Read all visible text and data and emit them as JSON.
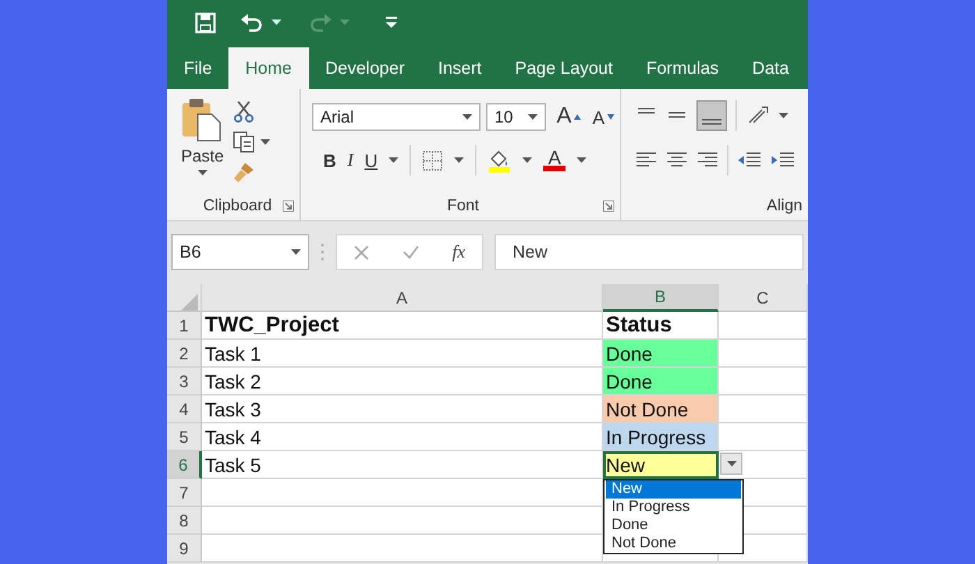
{
  "tabs": [
    {
      "label": "File",
      "selected": false
    },
    {
      "label": "Home",
      "selected": true
    },
    {
      "label": "Developer",
      "selected": false
    },
    {
      "label": "Insert",
      "selected": false
    },
    {
      "label": "Page Layout",
      "selected": false
    },
    {
      "label": "Formulas",
      "selected": false
    },
    {
      "label": "Data",
      "selected": false
    }
  ],
  "ribbon": {
    "clipboard": {
      "paste_label": "Paste",
      "label": "Clipboard"
    },
    "font": {
      "font_name": "Arial",
      "font_size": "10",
      "grow_label": "A",
      "shrink_label": "A",
      "bold_label": "B",
      "italic_label": "I",
      "underline_label": "U",
      "font_color_label": "A",
      "label": "Font"
    },
    "alignment": {
      "label": "Align"
    }
  },
  "formula_bar": {
    "name_box": "B6",
    "function_label": "fx",
    "value": "New"
  },
  "columns": [
    {
      "label": "A",
      "selected": false
    },
    {
      "label": "B",
      "selected": true
    },
    {
      "label": "C",
      "selected": false
    }
  ],
  "rows": [
    {
      "number": "1",
      "kind": "header",
      "selected": false,
      "a": "TWC_Project",
      "b": "Status"
    },
    {
      "number": "2",
      "kind": "data",
      "selected": false,
      "a": "Task 1",
      "b": "Done",
      "color": "#66ff99"
    },
    {
      "number": "3",
      "kind": "data",
      "selected": false,
      "a": "Task 2",
      "b": "Done",
      "color": "#66ff99"
    },
    {
      "number": "4",
      "kind": "data",
      "selected": false,
      "a": "Task 3",
      "b": "Not Done",
      "color": "#f8cbad"
    },
    {
      "number": "5",
      "kind": "data",
      "selected": false,
      "a": "Task 4",
      "b": "In Progress",
      "color": "#bdd7ee"
    },
    {
      "number": "6",
      "kind": "data",
      "selected": true,
      "a": "Task 5",
      "b": "New",
      "color": "#ffff99"
    },
    {
      "number": "7",
      "kind": "empty",
      "selected": false
    },
    {
      "number": "8",
      "kind": "empty",
      "selected": false
    },
    {
      "number": "9",
      "kind": "empty",
      "selected": false
    }
  ],
  "dropdown": {
    "options": [
      {
        "label": "New",
        "selected": true
      },
      {
        "label": "In Progress",
        "selected": false
      },
      {
        "label": "Done",
        "selected": false
      },
      {
        "label": "Not Done",
        "selected": false
      }
    ]
  }
}
